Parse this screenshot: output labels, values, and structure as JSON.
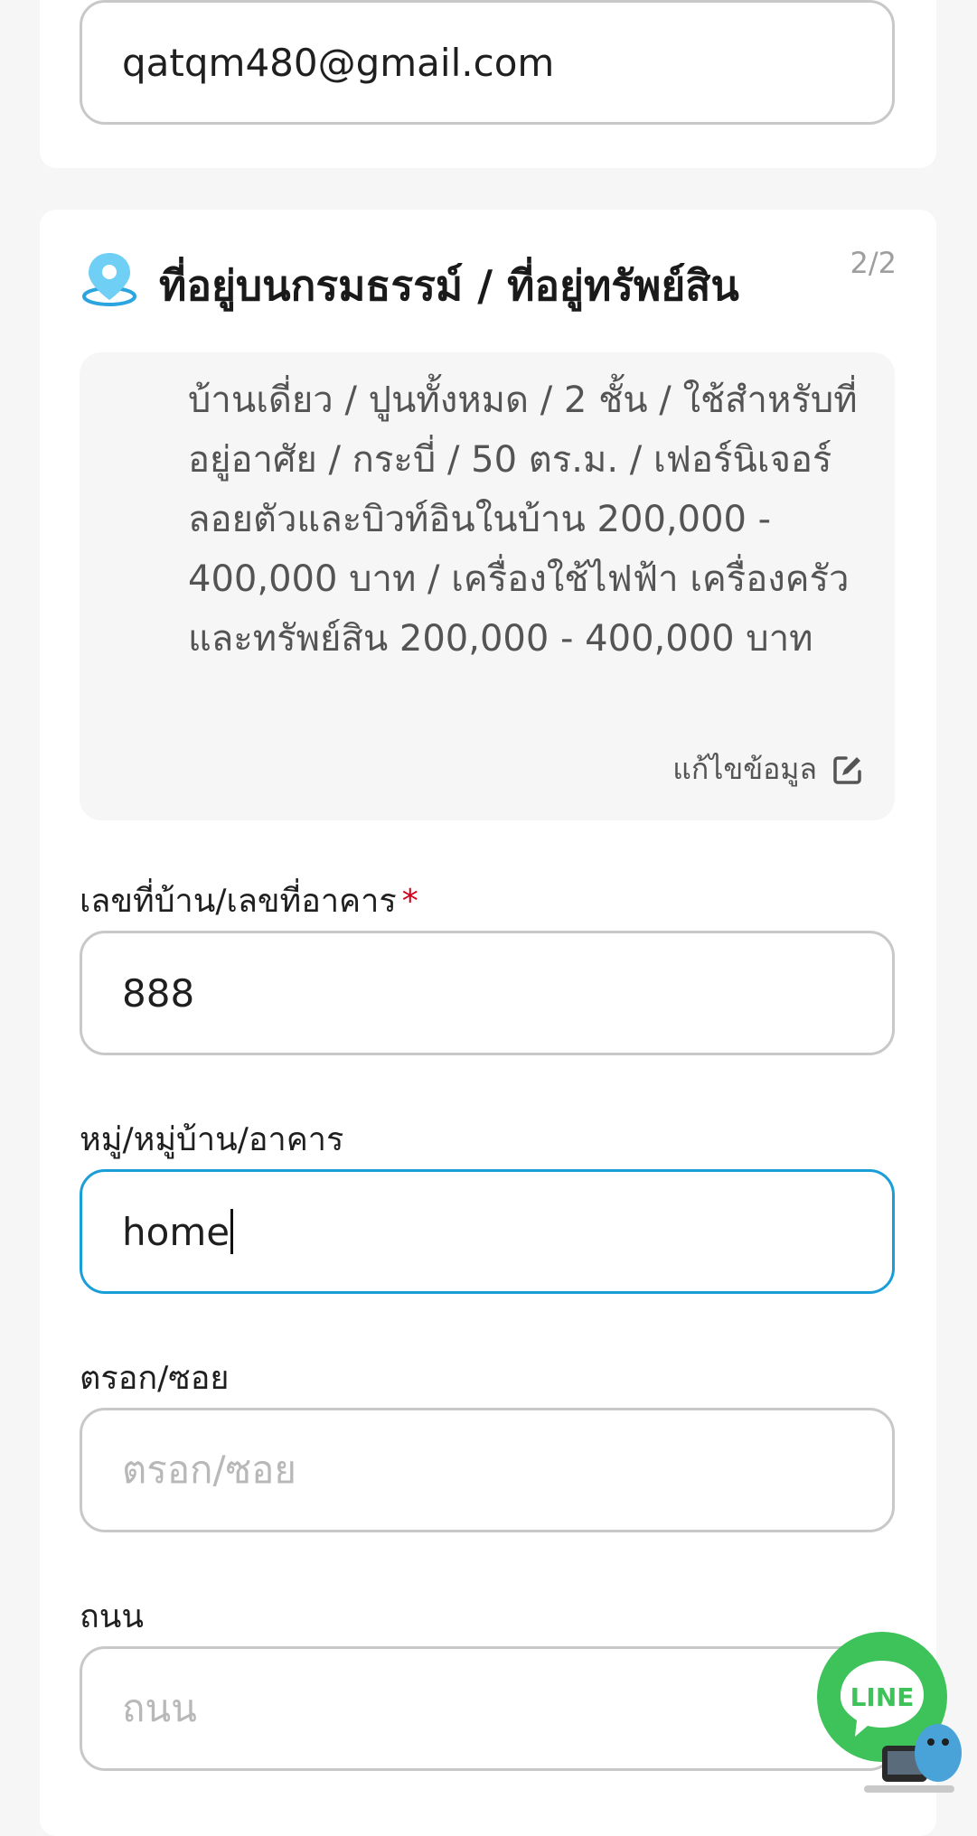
{
  "contact": {
    "email_value": "qatqm480@gmail.com"
  },
  "property_section": {
    "title": "ที่อยู่บนกรมธรรม์ / ที่อยู่ทรัพย์สิน",
    "page_indicator": "2/2",
    "summary_text": "บ้านเดี่ยว / ปูนทั้งหมด / 2 ชั้น / ใช้สำหรับที่อยู่อาศัย / กระบี่ / 50 ตร.ม. / เฟอร์นิเจอร์ลอยตัวและบิวท์อินในบ้าน 200,000 - 400,000 บาท / เครื่องใช้ไฟฟ้า เครื่องครัว และทรัพย์สิน 200,000 - 400,000 บาท",
    "edit_label": "แก้ไขข้อมูล"
  },
  "form": {
    "house_no": {
      "label": "เลขที่บ้าน/เลขที่อาคาร",
      "required_mark": "*",
      "value": "888"
    },
    "village": {
      "label": "หมู่/หมู่บ้าน/อาคาร",
      "value": "home"
    },
    "alley": {
      "label": "ตรอก/ซอย",
      "placeholder": "ตรอก/ซอย"
    },
    "road": {
      "label": "ถนน",
      "placeholder": "ถนน"
    }
  },
  "line_chat": {
    "label": "LINE",
    "icon": "line-chat-icon"
  },
  "colors": {
    "focus": "#1a9ed8",
    "required": "#d0021b",
    "line_green": "#3ec35a",
    "pin": "#2aa5e0"
  }
}
